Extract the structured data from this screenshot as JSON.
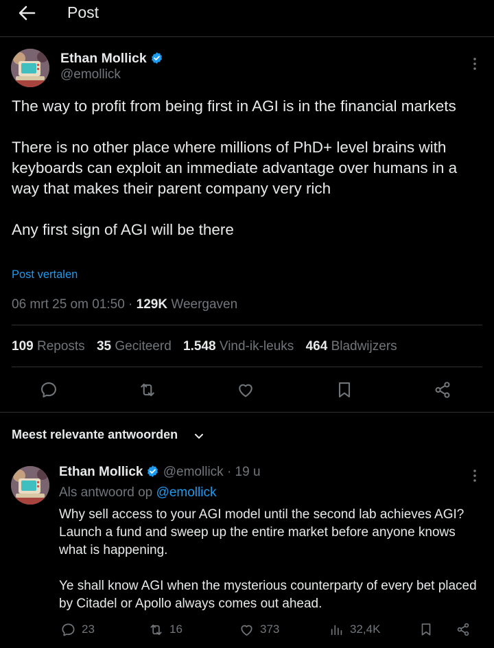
{
  "header": {
    "title": "Post"
  },
  "post": {
    "author": {
      "name": "Ethan Mollick",
      "handle": "@emollick"
    },
    "paragraphs": [
      "The way to profit from being first in AGI is in the financial markets",
      "There is no other place where millions of PhD+ level brains with keyboards can exploit an immediate advantage over humans in a way that makes their parent company very rich",
      "Any first sign of AGI will be there"
    ],
    "translate_label": "Post vertalen",
    "timestamp": "06 mrt 25 om 01:50",
    "separator": "·",
    "views_count": "129K",
    "views_label": "Weergaven",
    "stats": {
      "reposts_count": "109",
      "reposts_label": "Reposts",
      "quotes_count": "35",
      "quotes_label": "Geciteerd",
      "likes_count": "1.548",
      "likes_label": "Vind-ik-leuks",
      "bookmarks_count": "464",
      "bookmarks_label": "Bladwijzers"
    },
    "actions": [
      "reply-icon",
      "repost-icon",
      "like-icon",
      "bookmark-icon",
      "share-icon"
    ]
  },
  "replies_section": {
    "sort_label": "Meest relevante antwoorden"
  },
  "reply": {
    "author": {
      "name": "Ethan Mollick",
      "handle": "@emollick"
    },
    "time": "· 19 u",
    "reply_prefix": "Als antwoord op",
    "reply_to": "@emollick",
    "paragraphs": [
      "Why sell access to your AGI model until the second lab achieves AGI? Launch a fund and sweep up the entire market before anyone knows what is happening.",
      "Ye shall know AGI when the mysterious counterparty of every bet placed by Citadel or Apollo always comes out ahead."
    ],
    "counts": {
      "replies": "23",
      "reposts": "16",
      "likes": "373",
      "views": "32,4K"
    }
  },
  "colors": {
    "background": "#000000",
    "text": "#e7e9ea",
    "muted": "#71767b",
    "accent": "#1d9bf0",
    "divider": "#2f3336"
  }
}
